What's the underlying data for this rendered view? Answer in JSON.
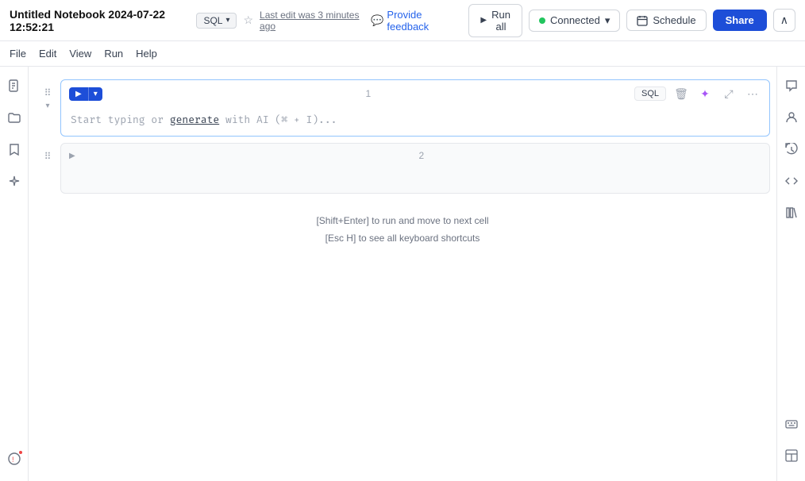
{
  "title": {
    "notebook_name": "Untitled Notebook 2024-07-22 12:52:21",
    "sql_label": "SQL",
    "chevron": "▾",
    "last_edit": "Last edit was 3 minutes ago",
    "feedback_label": "Provide feedback"
  },
  "toolbar": {
    "run_all_label": "Run all",
    "connected_label": "Connected",
    "schedule_label": "Schedule",
    "share_label": "Share",
    "collapse_label": "∧"
  },
  "cells": [
    {
      "number": "1",
      "type": "SQL",
      "placeholder": "Start typing or generate with AI (⌘ + I)..."
    },
    {
      "number": "2"
    }
  ],
  "hints": {
    "line1": "[Shift+Enter] to run and move to next cell",
    "line2": "[Esc H] to see all keyboard shortcuts"
  },
  "left_sidebar": {
    "icons": [
      "document",
      "folder",
      "bookmark",
      "sparkle"
    ]
  },
  "right_sidebar": {
    "icons": [
      "comment",
      "person",
      "history",
      "code",
      "library"
    ]
  },
  "colors": {
    "active_cell_border": "#93c5fd",
    "run_btn_bg": "#1d4ed8",
    "share_btn_bg": "#1d4ed8",
    "connected_dot": "#22c55e"
  }
}
